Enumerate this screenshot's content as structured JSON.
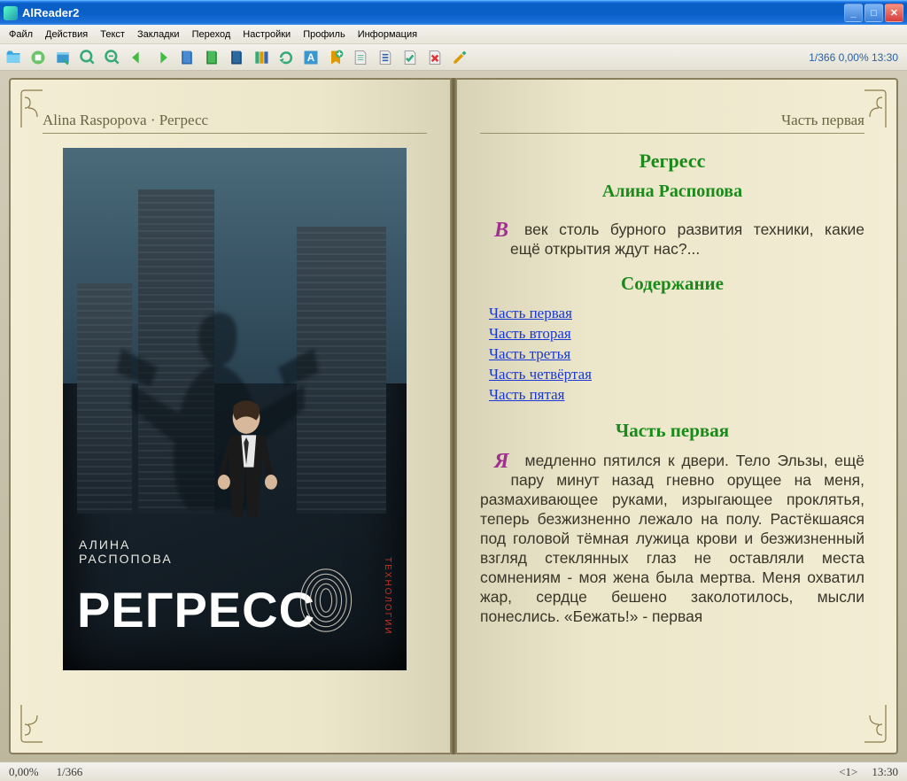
{
  "window": {
    "title": "AlReader2"
  },
  "menu": [
    "Файл",
    "Действия",
    "Текст",
    "Закладки",
    "Переход",
    "Настройки",
    "Профиль",
    "Информация"
  ],
  "toolbar_status": "1/366 0,00% 13:30",
  "left_page": {
    "header": "Alina Raspopova · Регресс",
    "cover": {
      "author": "АЛИНА\nРАСПОПОВА",
      "title": "РЕГРЕСС",
      "side": "ТЕХНОЛОГИИ"
    }
  },
  "right_page": {
    "header": "Часть первая",
    "title": "Регресс",
    "author": "Алина Распопова",
    "intro_drop": "В",
    "intro": " век столь бурного развития техники, какие ещё открытия ждут нас?...",
    "toc_heading": "Содержание",
    "toc": [
      "Часть первая",
      "Часть вторая",
      "Часть третья",
      "Часть четвёртая",
      "Часть пятая"
    ],
    "chapter_heading": "Часть первая",
    "p1_drop": "Я",
    "p1": " медленно пятился к двери. Тело Эльзы, ещё пару минут назад гневно орущее на меня, размахивающее руками, изрыгающее проклятья, теперь безжизненно лежало на полу. Растёкшаяся под головой тёмная лужица крови и безжизненный взгляд стеклянных глаз не оставляли места сомнениям - моя жена была мертва. Меня охватил жар, сердце бешено заколотилось, мысли понеслись. «Бежать!» - первая"
  },
  "statusbar": {
    "percent": "0,00%",
    "pages": "1/366",
    "battery": "<1>",
    "clock": "13:30"
  }
}
